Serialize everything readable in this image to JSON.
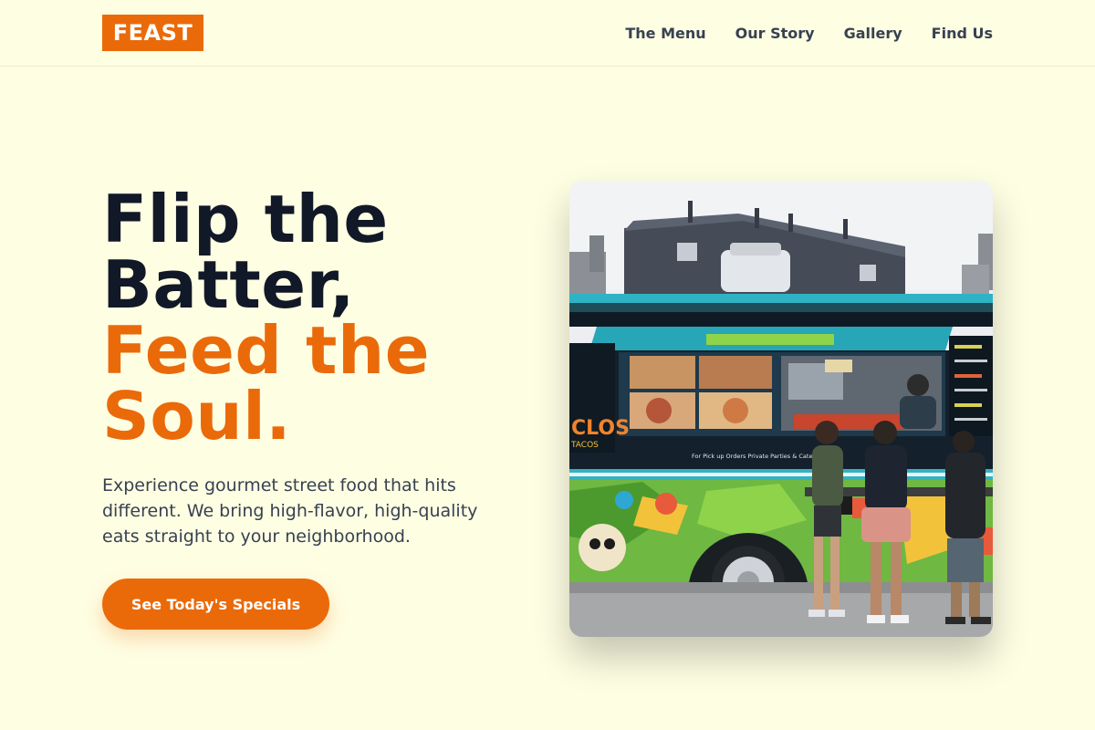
{
  "brand": {
    "logo_text": "FEAST",
    "accent": "#ea6a0a"
  },
  "nav": {
    "items": [
      {
        "label": "The Menu"
      },
      {
        "label": "Our Story"
      },
      {
        "label": "Gallery"
      },
      {
        "label": "Find Us"
      }
    ]
  },
  "hero": {
    "title_line1": "Flip the",
    "title_line2": "Batter,",
    "title_line3": "Feed the",
    "title_line4": "Soul.",
    "description": "Experience gourmet street food that hits different. We bring high-flavor, high-quality eats straight to your neighborhood.",
    "cta_label": "See Today's Specials",
    "image_alt": "food-truck-photo"
  },
  "truck": {
    "side_text": "For Pick up Orders Private Parties & Catering Plea",
    "sign_left": "CLOS",
    "sign_left_sub": "TACOS"
  }
}
